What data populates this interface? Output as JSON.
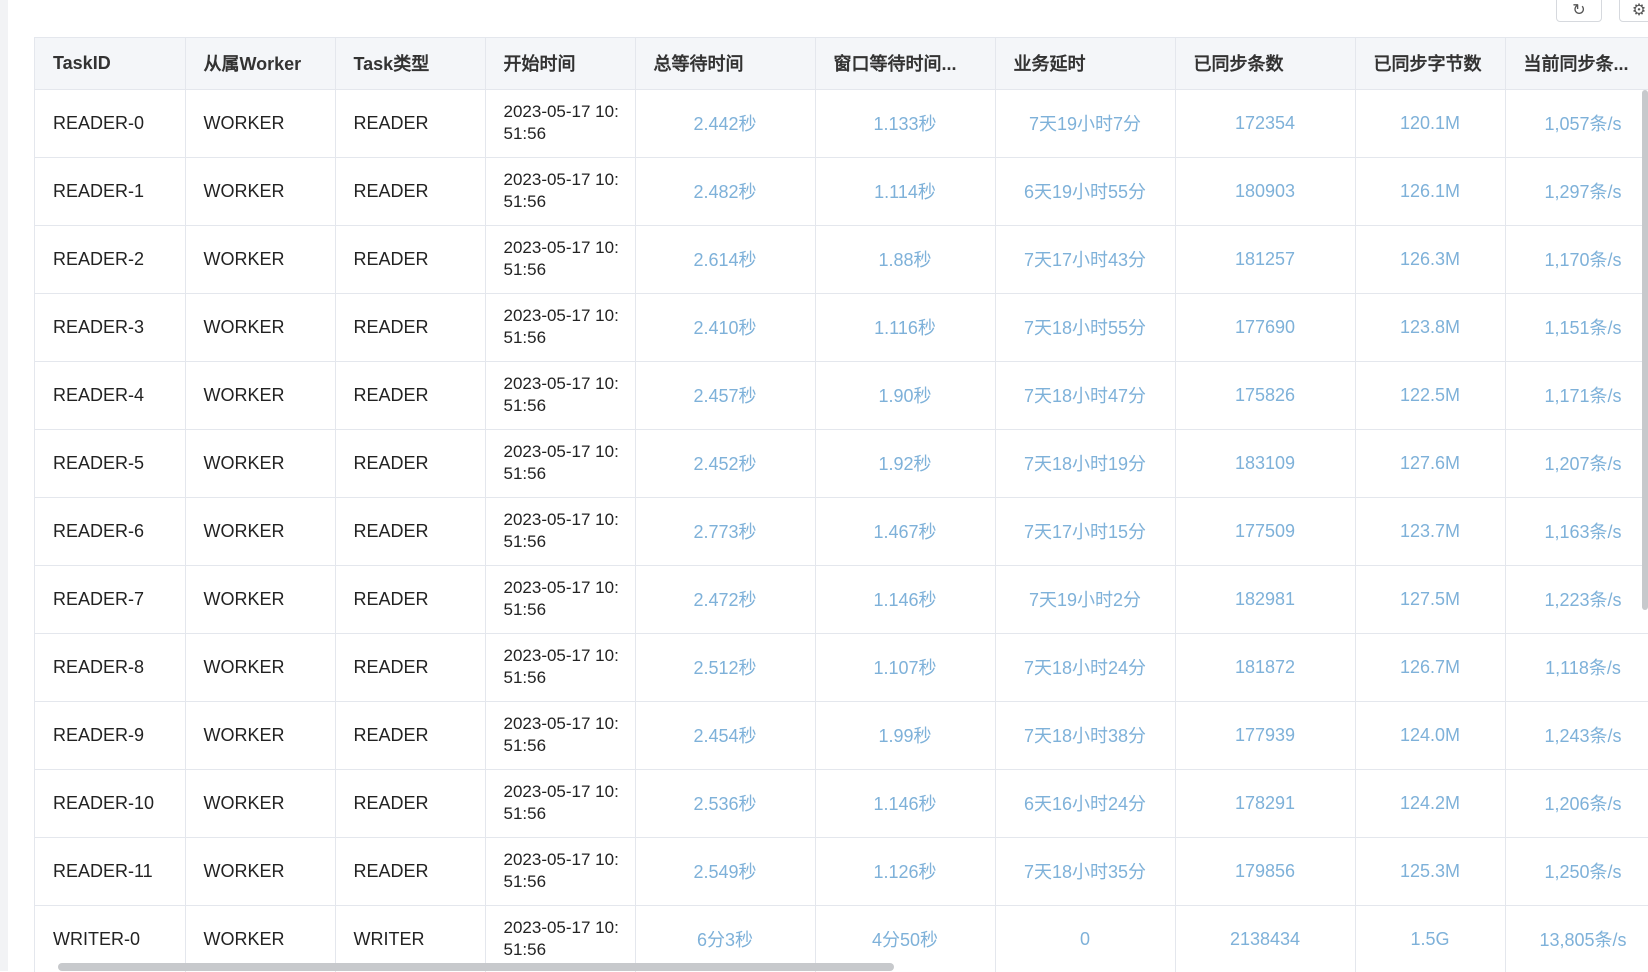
{
  "toolbar": {
    "refresh_icon": "↻",
    "settings_icon": "⚙"
  },
  "table": {
    "headers": [
      "TaskID",
      "从属Worker",
      "Task类型",
      "开始时间",
      "总等待时间",
      "窗口等待时间...",
      "业务延时",
      "已同步条数",
      "已同步字节数",
      "当前同步条..."
    ],
    "rows": [
      [
        "READER-0",
        "WORKER",
        "READER",
        "2023-05-17 10:51:56",
        "2.442秒",
        "1.133秒",
        "7天19小时7分",
        "172354",
        "120.1M",
        "1,057条/s"
      ],
      [
        "READER-1",
        "WORKER",
        "READER",
        "2023-05-17 10:51:56",
        "2.482秒",
        "1.114秒",
        "6天19小时55分",
        "180903",
        "126.1M",
        "1,297条/s"
      ],
      [
        "READER-2",
        "WORKER",
        "READER",
        "2023-05-17 10:51:56",
        "2.614秒",
        "1.88秒",
        "7天17小时43分",
        "181257",
        "126.3M",
        "1,170条/s"
      ],
      [
        "READER-3",
        "WORKER",
        "READER",
        "2023-05-17 10:51:56",
        "2.410秒",
        "1.116秒",
        "7天18小时55分",
        "177690",
        "123.8M",
        "1,151条/s"
      ],
      [
        "READER-4",
        "WORKER",
        "READER",
        "2023-05-17 10:51:56",
        "2.457秒",
        "1.90秒",
        "7天18小时47分",
        "175826",
        "122.5M",
        "1,171条/s"
      ],
      [
        "READER-5",
        "WORKER",
        "READER",
        "2023-05-17 10:51:56",
        "2.452秒",
        "1.92秒",
        "7天18小时19分",
        "183109",
        "127.6M",
        "1,207条/s"
      ],
      [
        "READER-6",
        "WORKER",
        "READER",
        "2023-05-17 10:51:56",
        "2.773秒",
        "1.467秒",
        "7天17小时15分",
        "177509",
        "123.7M",
        "1,163条/s"
      ],
      [
        "READER-7",
        "WORKER",
        "READER",
        "2023-05-17 10:51:56",
        "2.472秒",
        "1.146秒",
        "7天19小时2分",
        "182981",
        "127.5M",
        "1,223条/s"
      ],
      [
        "READER-8",
        "WORKER",
        "READER",
        "2023-05-17 10:51:56",
        "2.512秒",
        "1.107秒",
        "7天18小时24分",
        "181872",
        "126.7M",
        "1,118条/s"
      ],
      [
        "READER-9",
        "WORKER",
        "READER",
        "2023-05-17 10:51:56",
        "2.454秒",
        "1.99秒",
        "7天18小时38分",
        "177939",
        "124.0M",
        "1,243条/s"
      ],
      [
        "READER-10",
        "WORKER",
        "READER",
        "2023-05-17 10:51:56",
        "2.536秒",
        "1.146秒",
        "6天16小时24分",
        "178291",
        "124.2M",
        "1,206条/s"
      ],
      [
        "READER-11",
        "WORKER",
        "READER",
        "2023-05-17 10:51:56",
        "2.549秒",
        "1.126秒",
        "7天18小时35分",
        "179856",
        "125.3M",
        "1,250条/s"
      ],
      [
        "WRITER-0",
        "WORKER",
        "WRITER",
        "2023-05-17 10:51:56",
        "6分3秒",
        "4分50秒",
        "0",
        "2138434",
        "1.5G",
        "13,805条/s"
      ]
    ]
  }
}
